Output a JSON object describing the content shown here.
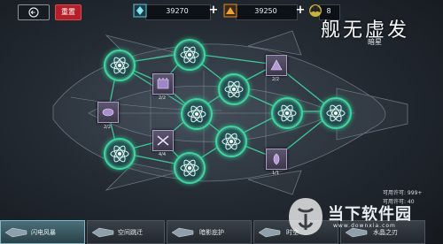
{
  "top_bar": {
    "back_icon": "back-arrow-icon",
    "reset_label": "重置",
    "crystal": {
      "icon": "crystal-icon",
      "value": "39270"
    },
    "ore": {
      "icon": "ore-icon",
      "value": "39250"
    },
    "radiation": {
      "icon": "radiation-icon",
      "value": "8"
    }
  },
  "logo": {
    "title": "舰无虚发",
    "subtitle": "暗星"
  },
  "nodes": {
    "small_counts": [
      "2/2",
      "2/2",
      "2/2",
      "4/4",
      "1/1"
    ]
  },
  "stats": {
    "available": "可用许可: 999+",
    "cost_partial": "可用许可: 40"
  },
  "tabs": [
    {
      "label": "闪电风暴",
      "active": true
    },
    {
      "label": "空间跳迁",
      "active": false
    },
    {
      "label": "暗影庇护",
      "active": false
    },
    {
      "label": "时空",
      "active": false
    },
    {
      "label": "水晶之刃",
      "active": false
    }
  ],
  "watermark": {
    "text": "当下软件园",
    "url": "www.downxia.com"
  },
  "colors": {
    "accent_green": "#3fd6a0",
    "reset_red": "#b4202a",
    "node_fill": "#1d4448",
    "box_purple": "#5d5670"
  }
}
